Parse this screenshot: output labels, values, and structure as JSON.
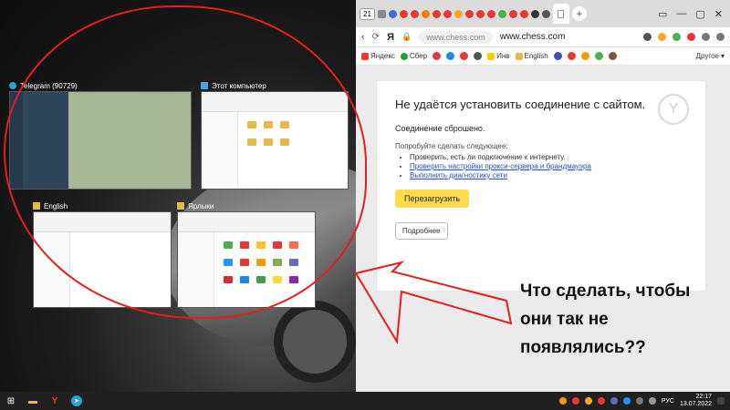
{
  "snap": {
    "windows": [
      {
        "title": "Telegram (90729)",
        "kind": "telegram"
      },
      {
        "title": "Этот компьютер",
        "kind": "explorer"
      },
      {
        "title": "English",
        "kind": "explorer"
      },
      {
        "title": "Ярлыки",
        "kind": "explorer"
      }
    ]
  },
  "browser": {
    "tab_count": "21",
    "address_pill": "www.chess.com",
    "address_text": "www.chess.com",
    "bookmarks": [
      {
        "label": "Яндекс",
        "color": "#f33"
      },
      {
        "label": "Сбер",
        "color": "#21a038"
      },
      {
        "label": "Инв",
        "color": "#ffcc00"
      },
      {
        "label": "English",
        "color": "#999"
      }
    ],
    "bookmarks_more": "Другое",
    "window_controls": [
      "▭",
      "—",
      "▢",
      "✕"
    ]
  },
  "error": {
    "title": "Не удаётся установить соединение с сайтом.",
    "subtitle": "Соединение сброшено.",
    "try_label": "Попробуйте сделать следующее:",
    "suggestions": [
      "Проверить, есть ли подключение к интернету.",
      "Проверить настройки прокси-сервера и брандмауэра",
      "Выполнить диагностику сети"
    ],
    "reload_label": "Перезагрузить",
    "details_label": "Подробнее"
  },
  "annotation": {
    "question": "Что сделать, чтобы они так не появлялись??",
    "color": "#e61d1d"
  },
  "taskbar": {
    "lang": "РУС",
    "time": "22:17",
    "date": "13.07.2022"
  }
}
